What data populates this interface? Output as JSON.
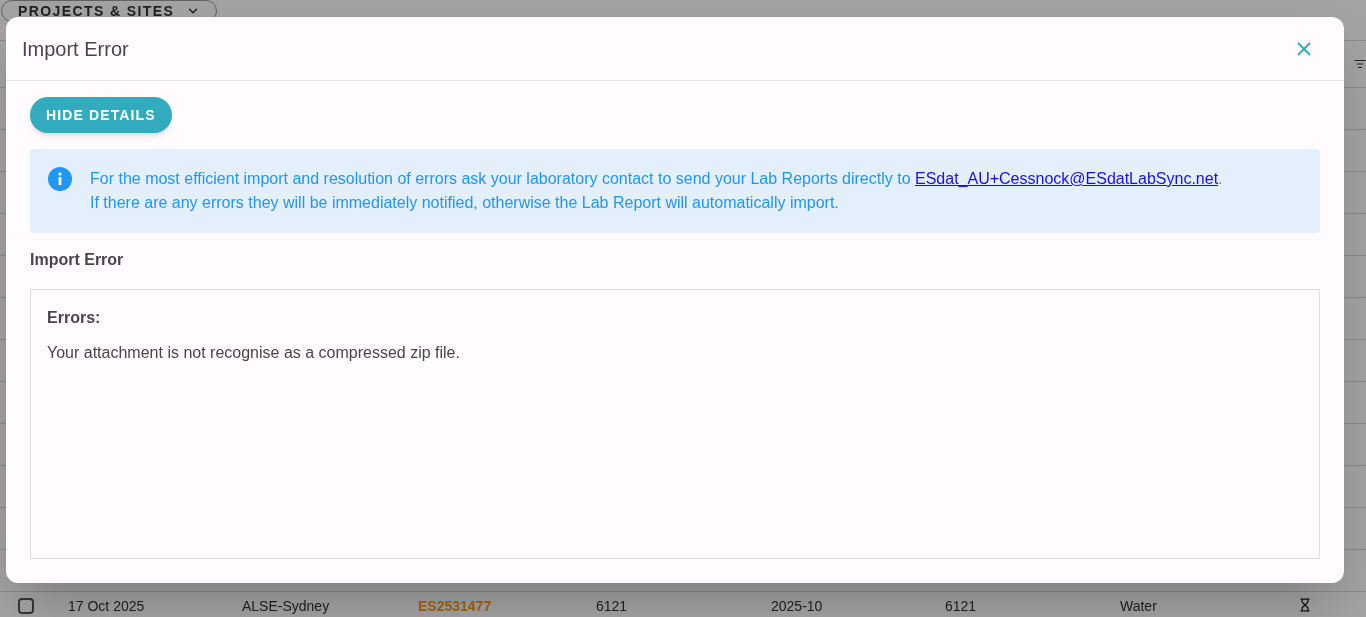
{
  "background": {
    "toolbar_button": "PROJECTS & SITES",
    "table": {
      "rows": [
        {
          "checked": false,
          "cells": [
            {
              "kind": "text",
              "text": "17 Oct 2025"
            },
            {
              "kind": "text",
              "text": "ALSE-Sydney"
            },
            {
              "kind": "link",
              "text": "ES2531477"
            },
            {
              "kind": "text",
              "text": "6121"
            },
            {
              "kind": "text",
              "text": "2025-10"
            },
            {
              "kind": "text",
              "text": "6121"
            },
            {
              "kind": "text",
              "text": "Water"
            }
          ]
        }
      ]
    }
  },
  "dialog": {
    "title": "Import Error",
    "details_button": "HIDE DETAILS",
    "info": {
      "text": "For the most efficient import and resolution of errors ask your laboratory contact to send your Lab Reports directly to ",
      "link": "ESdat_AU+Cessnock@ESdatLabSync.net",
      "text_after": ".",
      "line_2": "If there are any errors they will be immediately notified, otherwise the Lab Report will automatically import."
    },
    "section_title": "Import Error",
    "errors": {
      "label": "Errors:",
      "messages": [
        "Your attachment is not recognise as a compressed zip file."
      ]
    }
  }
}
